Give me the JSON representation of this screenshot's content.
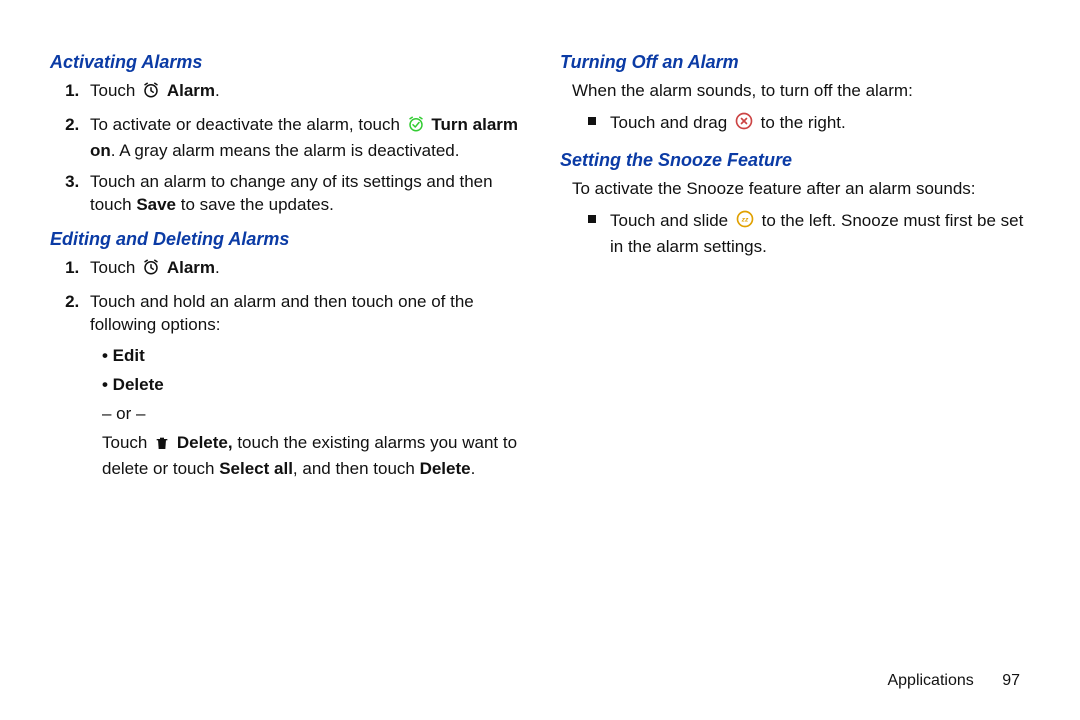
{
  "left": {
    "sec1": {
      "title": "Activating Alarms",
      "li1_a": "Touch",
      "li1_b": "Alarm",
      "li1_c": ".",
      "li2_a": "To activate or deactivate the alarm, touch",
      "li2_b": "Turn alarm on",
      "li2_c": ". A gray alarm means the alarm is deactivated.",
      "li3_a": "Touch an alarm to change any of its settings and then touch ",
      "li3_b": "Save",
      "li3_c": " to save the updates."
    },
    "sec2": {
      "title": "Editing and Deleting Alarms",
      "li1_a": "Touch",
      "li1_b": "Alarm",
      "li1_c": ".",
      "li2": "Touch and hold an alarm and then touch one of the following options:",
      "bullet_edit": "• Edit",
      "bullet_delete": "• Delete",
      "or": "– or –",
      "tail_a": "Touch",
      "tail_b": "Delete,",
      "tail_c": " touch the existing alarms you want to delete or touch ",
      "tail_d": "Select all",
      "tail_e": ", and then touch ",
      "tail_f": "Delete",
      "tail_g": "."
    }
  },
  "right": {
    "sec1": {
      "title": "Turning Off an Alarm",
      "intro": "When the alarm sounds, to turn off the alarm:",
      "b1_a": "Touch and drag",
      "b1_b": "to the right."
    },
    "sec2": {
      "title": "Setting the Snooze Feature",
      "intro": "To activate the Snooze feature after an alarm sounds:",
      "b1_a": "Touch and slide",
      "b1_b": "to the left. Snooze must first be set in the alarm settings."
    }
  },
  "footer": {
    "label": "Applications",
    "page": "97"
  }
}
